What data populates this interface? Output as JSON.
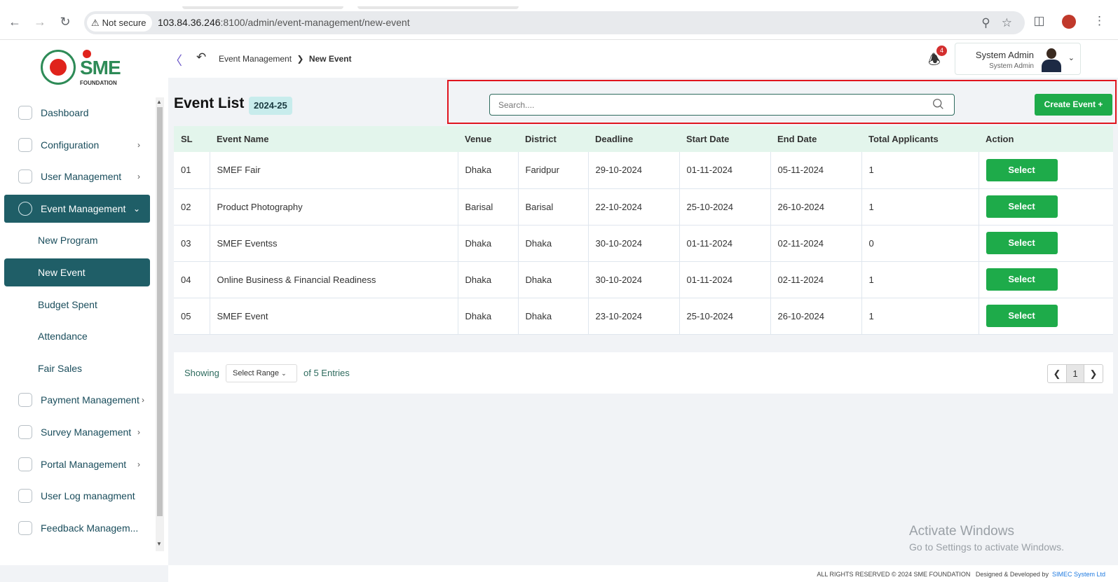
{
  "browser": {
    "security_label": "Not secure",
    "url_host": "103.84.36.246",
    "url_rest": ":8100/admin/event-management/new-event"
  },
  "sidebar": {
    "logo_text": "SME",
    "logo_sub": "FOUNDATION",
    "items": [
      {
        "label": "Dashboard",
        "has_chevron": false
      },
      {
        "label": "Configuration",
        "has_chevron": true
      },
      {
        "label": "User Management",
        "has_chevron": true
      },
      {
        "label": "Event Management",
        "has_chevron": true,
        "active": true
      },
      {
        "label": "Payment Management",
        "has_chevron": true
      },
      {
        "label": "Survey Management",
        "has_chevron": true
      },
      {
        "label": "Portal Management",
        "has_chevron": true
      },
      {
        "label": "User Log managment",
        "has_chevron": false
      },
      {
        "label": "Feedback Managem...",
        "has_chevron": false
      }
    ],
    "subitems": [
      {
        "label": "New Program"
      },
      {
        "label": "New Event",
        "active": true
      },
      {
        "label": "Budget Spent"
      },
      {
        "label": "Attendance"
      },
      {
        "label": "Fair Sales"
      }
    ]
  },
  "header": {
    "breadcrumb_parent": "Event Management",
    "breadcrumb_current": "New Event",
    "notification_count": "4",
    "user_name": "System Admin",
    "user_role": "System Admin"
  },
  "main": {
    "title": "Event List",
    "year_badge": "2024-25",
    "search_placeholder": "Search....",
    "create_button": "Create Event +",
    "columns": [
      "SL",
      "Event Name",
      "Venue",
      "District",
      "Deadline",
      "Start Date",
      "End Date",
      "Total Applicants",
      "Action"
    ],
    "rows": [
      [
        "01",
        "SMEF Fair",
        "Dhaka",
        "Faridpur",
        "29-10-2024",
        "01-11-2024",
        "05-11-2024",
        "1",
        "Select"
      ],
      [
        "02",
        "Product Photography",
        "Barisal",
        "Barisal",
        "22-10-2024",
        "25-10-2024",
        "26-10-2024",
        "1",
        "Select"
      ],
      [
        "03",
        "SMEF Eventss",
        "Dhaka",
        "Dhaka",
        "30-10-2024",
        "01-11-2024",
        "02-11-2024",
        "0",
        "Select"
      ],
      [
        "04",
        "Online Business & Financial Readiness",
        "Dhaka",
        "Dhaka",
        "30-10-2024",
        "01-11-2024",
        "02-11-2024",
        "1",
        "Select"
      ],
      [
        "05",
        "SMEF Event",
        "Dhaka",
        "Dhaka",
        "23-10-2024",
        "25-10-2024",
        "26-10-2024",
        "1",
        "Select"
      ]
    ]
  },
  "pagination": {
    "showing_label": "Showing",
    "range_label": "Select Range",
    "entries_label": "of 5 Entries",
    "current_page": "1"
  },
  "watermark": {
    "line1": "Activate Windows",
    "line2": "Go to Settings to activate Windows."
  },
  "footer": {
    "rights": "ALL RIGHTS RESERVED © 2024 SME FOUNDATION",
    "designed": "Designed & Developed by",
    "developer": "SIMEC System Ltd"
  },
  "colors": {
    "sidebar_active": "#1f5e67",
    "primary_button": "#1eab4a",
    "table_header": "#e3f5ec",
    "highlight_border": "#e0141e"
  }
}
